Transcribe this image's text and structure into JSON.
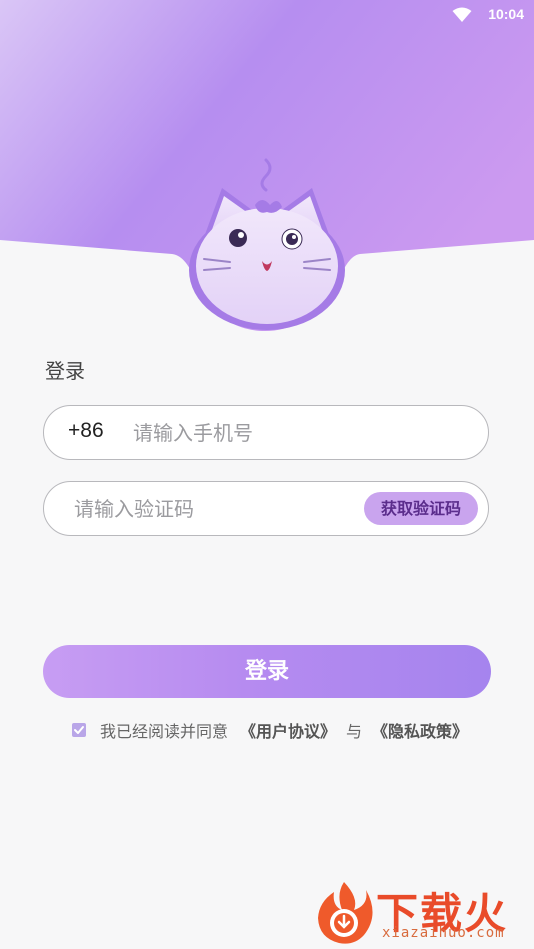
{
  "status_bar": {
    "time": "10:04",
    "wifi_icon": "wifi-icon"
  },
  "mascot_icon": "cat-mascot-icon",
  "login_form": {
    "heading": "登录",
    "phone": {
      "country_code": "+86",
      "placeholder": "请输入手机号",
      "value": ""
    },
    "code": {
      "placeholder": "请输入验证码",
      "value": "",
      "get_code_label": "获取验证码"
    },
    "submit_label": "登录"
  },
  "agreement": {
    "checked": true,
    "prefix_text": "我已经阅读并同意",
    "user_agreement_link": "《用户协议》",
    "connector": "与",
    "privacy_policy_link": "《隐私政策》"
  },
  "watermark": {
    "brand": "下载火",
    "domain": "xiazaihuo.com"
  },
  "colors": {
    "header_gradient_start": "#d7c0f5",
    "header_gradient_end": "#b98df0",
    "accent": "#b68bf0",
    "background": "#f7f7f8"
  }
}
